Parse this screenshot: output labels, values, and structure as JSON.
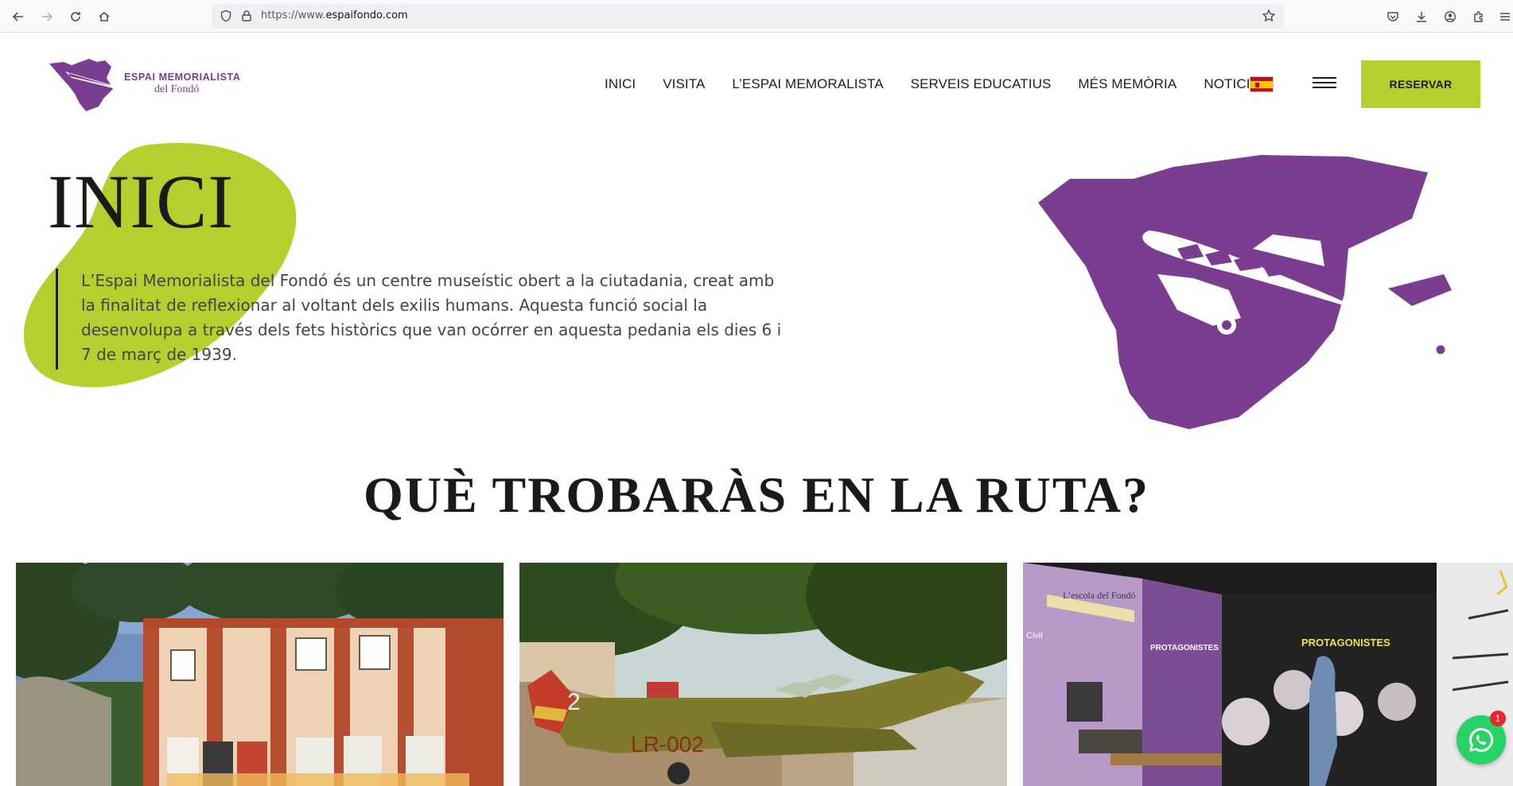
{
  "browser": {
    "url_prefix": "https://www.",
    "url_domain": "espaifondo.com"
  },
  "logo": {
    "line1": "ESPAI MEMORIALISTA",
    "line2": "del Fondó"
  },
  "nav": {
    "items": [
      "INICI",
      "VISITA",
      "L’ESPAI MEMORALISTA",
      "SERVEIS EDUCATIUS",
      "MÉS MEMÒRIA",
      "NOTICIES"
    ],
    "reserve_label": "RESERVAR"
  },
  "hero": {
    "title": "INICI",
    "lines": [
      "L’Espai Memorialista del Fondó és un centre museístic obert a la ciutadania, creat amb",
      "la finalitat de reflexionar al voltant dels exilis humans. Aquesta funció social la",
      "desenvolupa a través dels fets històrics que van ocórrer en aquesta pedania els dies 6 i",
      "7 de març de 1939."
    ]
  },
  "section": {
    "title": "QUÈ TROBARÀS EN LA RUTA?"
  },
  "card3_labels": {
    "panel1": "L’escola del Fondó",
    "panel2": "PROTAGONISTES",
    "panel3": "PROTAGONISTES",
    "civil": "Civil"
  },
  "card2_labels": {
    "tail_number": "2",
    "registration": "LR-002"
  },
  "whatsapp": {
    "badge_count": "1"
  },
  "colors": {
    "purple": "#7b3d8f",
    "lime": "#b5cf2f",
    "whatsapp": "#25d366"
  }
}
